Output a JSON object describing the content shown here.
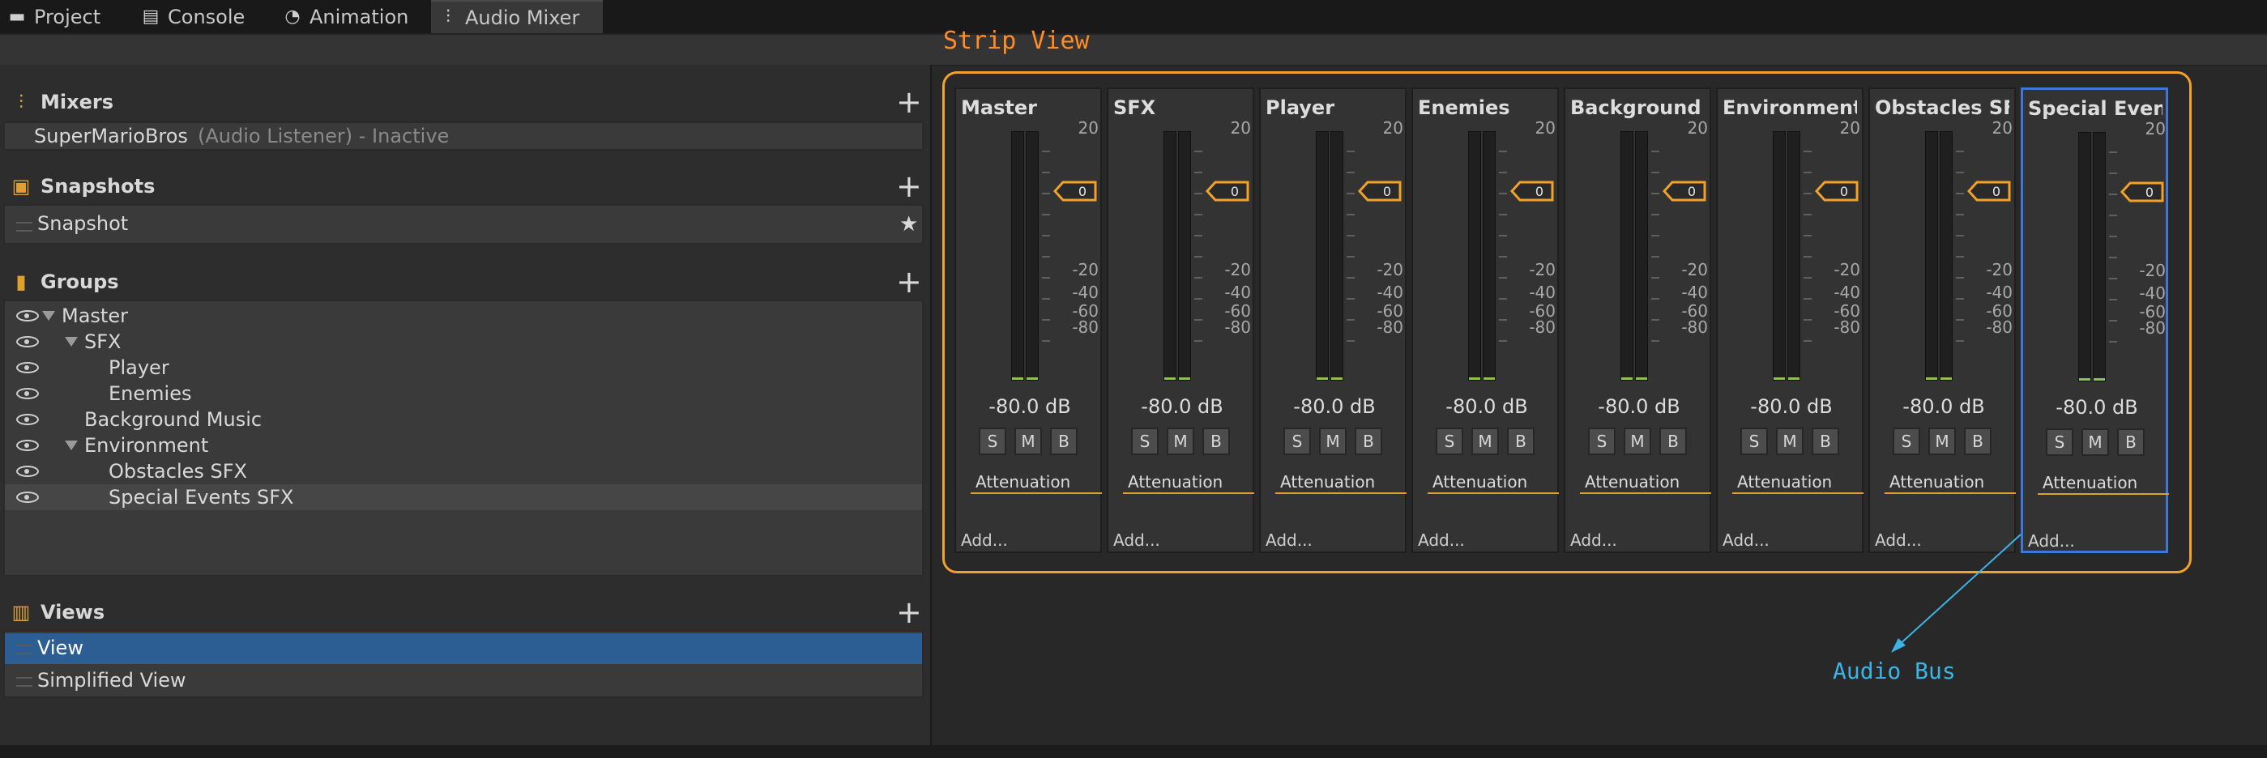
{
  "tabs": [
    {
      "label": "Project",
      "icon": "folder-icon"
    },
    {
      "label": "Console",
      "icon": "console-icon"
    },
    {
      "label": "Animation",
      "icon": "animation-icon"
    },
    {
      "label": "Audio Mixer",
      "icon": "mixer-icon"
    }
  ],
  "active_tab": "Audio Mixer",
  "sections": {
    "mixers": {
      "title": "Mixers",
      "items": [
        {
          "name": "SuperMarioBros",
          "status": "(Audio Listener) - Inactive"
        }
      ]
    },
    "snapshots": {
      "title": "Snapshots",
      "items": [
        {
          "name": "Snapshot",
          "starred": true
        }
      ]
    },
    "groups": {
      "title": "Groups",
      "items": [
        {
          "name": "Master",
          "expandable": true
        },
        {
          "name": "SFX",
          "expandable": true
        },
        {
          "name": "Player",
          "expandable": false
        },
        {
          "name": "Enemies",
          "expandable": false
        },
        {
          "name": "Background Music",
          "expandable": false
        },
        {
          "name": "Environment",
          "expandable": true
        },
        {
          "name": "Obstacles SFX",
          "expandable": false
        },
        {
          "name": "Special Events SFX",
          "expandable": false
        }
      ],
      "selected": "Special Events SFX"
    },
    "views": {
      "title": "Views",
      "items": [
        {
          "name": "View"
        },
        {
          "name": "Simplified View"
        }
      ],
      "selected": "View"
    }
  },
  "annotations": {
    "strip_view": "Strip View",
    "audio_bus": "Audio Bus"
  },
  "strips": [
    {
      "name": "Master",
      "db": "-80.0 dB",
      "fader": "0",
      "effect": "Attenuation",
      "add": "Add..."
    },
    {
      "name": "SFX",
      "db": "-80.0 dB",
      "fader": "0",
      "effect": "Attenuation",
      "add": "Add..."
    },
    {
      "name": "Player",
      "db": "-80.0 dB",
      "fader": "0",
      "effect": "Attenuation",
      "add": "Add..."
    },
    {
      "name": "Enemies",
      "db": "-80.0 dB",
      "fader": "0",
      "effect": "Attenuation",
      "add": "Add..."
    },
    {
      "name": "Background M",
      "db": "-80.0 dB",
      "fader": "0",
      "effect": "Attenuation",
      "add": "Add..."
    },
    {
      "name": "Environment",
      "db": "-80.0 dB",
      "fader": "0",
      "effect": "Attenuation",
      "add": "Add..."
    },
    {
      "name": "Obstacles SFX",
      "db": "-80.0 dB",
      "fader": "0",
      "effect": "Attenuation",
      "add": "Add..."
    },
    {
      "name": "Special Events",
      "db": "-80.0 dB",
      "fader": "0",
      "effect": "Attenuation",
      "add": "Add..."
    }
  ],
  "selected_strip": "Special Events",
  "meter_scale": [
    "20",
    "0",
    "-20",
    "-40",
    "-60",
    "-80"
  ],
  "buttons": {
    "solo": "S",
    "mute": "M",
    "bypass": "B"
  },
  "colors": {
    "accent_orange": "#f2a22a",
    "annotation_orange": "#ff8c28",
    "annotation_blue": "#3cb4e6",
    "selection_blue": "#2c5d93",
    "meter_green": "#8ec34d"
  }
}
